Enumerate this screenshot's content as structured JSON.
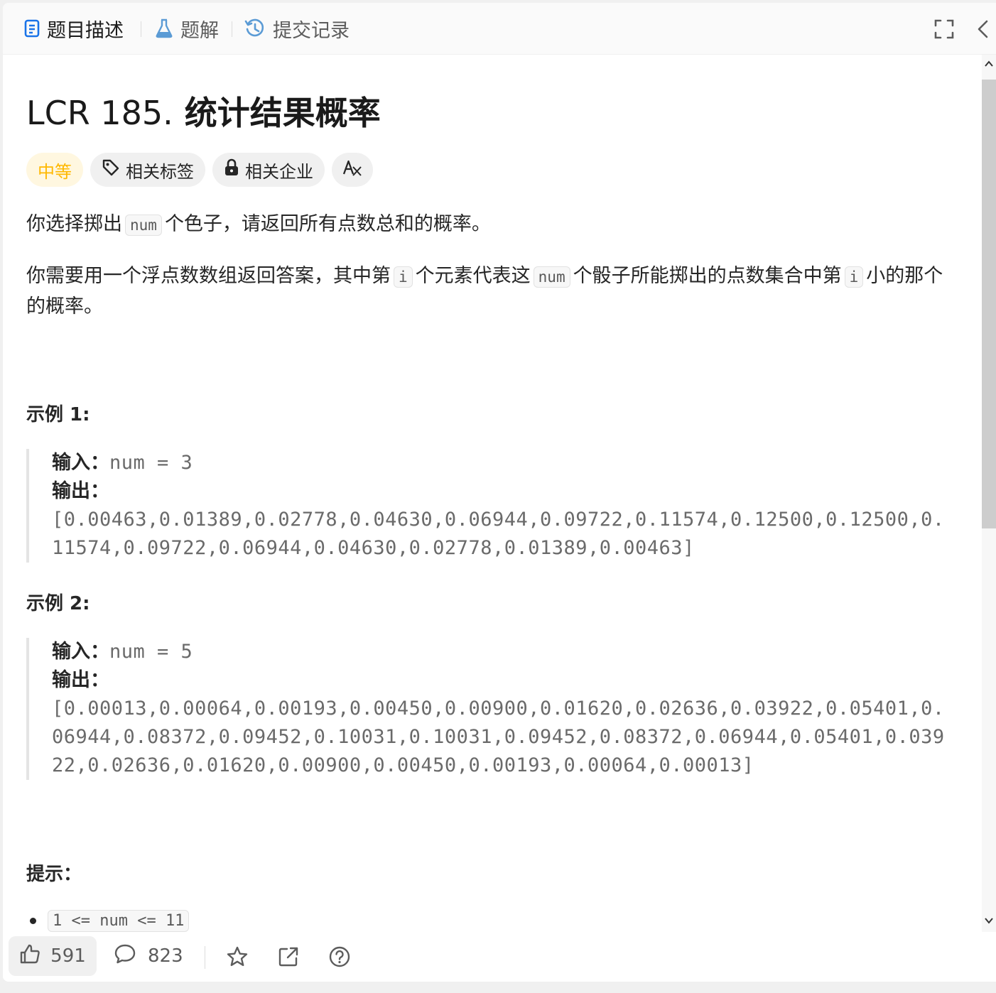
{
  "tabs": [
    {
      "label": "题目描述",
      "icon": "document-icon",
      "active": true
    },
    {
      "label": "题解",
      "icon": "flask-icon",
      "active": false
    },
    {
      "label": "提交记录",
      "icon": "history-icon",
      "active": false
    }
  ],
  "problem": {
    "number": "LCR 185.",
    "name": "统计结果概率",
    "difficulty": "中等",
    "chips": {
      "tags": "相关标签",
      "companies": "相关企业",
      "translate": "A文"
    }
  },
  "description": {
    "p1_a": "你选择掷出",
    "p1_code": "num",
    "p1_b": "个色子，请返回所有点数总和的概率。",
    "p2_a": "你需要用一个浮点数数组返回答案，其中第",
    "p2_code1": "i",
    "p2_b": "个元素代表这",
    "p2_code2": "num",
    "p2_c": "个骰子所能掷出的点数集合中第",
    "p2_code3": "i",
    "p2_d": "小的那个的概率。"
  },
  "examples": [
    {
      "heading": "示例 1:",
      "input_label": "输入：",
      "input": "num = 3",
      "output_label": "输出：",
      "output": "[0.00463,0.01389,0.02778,0.04630,0.06944,0.09722,0.11574,0.12500,0.12500,0.11574,0.09722,0.06944,0.04630,0.02778,0.01389,0.00463]"
    },
    {
      "heading": "示例 2:",
      "input_label": "输入：",
      "input": "num = 5",
      "output_label": "输出：",
      "output": "[0.00013,0.00064,0.00193,0.00450,0.00900,0.01620,0.02636,0.03922,0.05401,0.06944,0.08372,0.09452,0.10031,0.10031,0.09452,0.08372,0.06944,0.05401,0.03922,0.02636,0.01620,0.00900,0.00450,0.00193,0.00064,0.00013]"
    }
  ],
  "hints": {
    "heading": "提示：",
    "items": [
      "1 <= num <= 11"
    ]
  },
  "actions": {
    "likes": "591",
    "comments": "823"
  },
  "colors": {
    "accent": "#1a73e8",
    "difficulty_medium": "#ffb800",
    "difficulty_bg": "#fff7e0",
    "text": "#262626"
  }
}
